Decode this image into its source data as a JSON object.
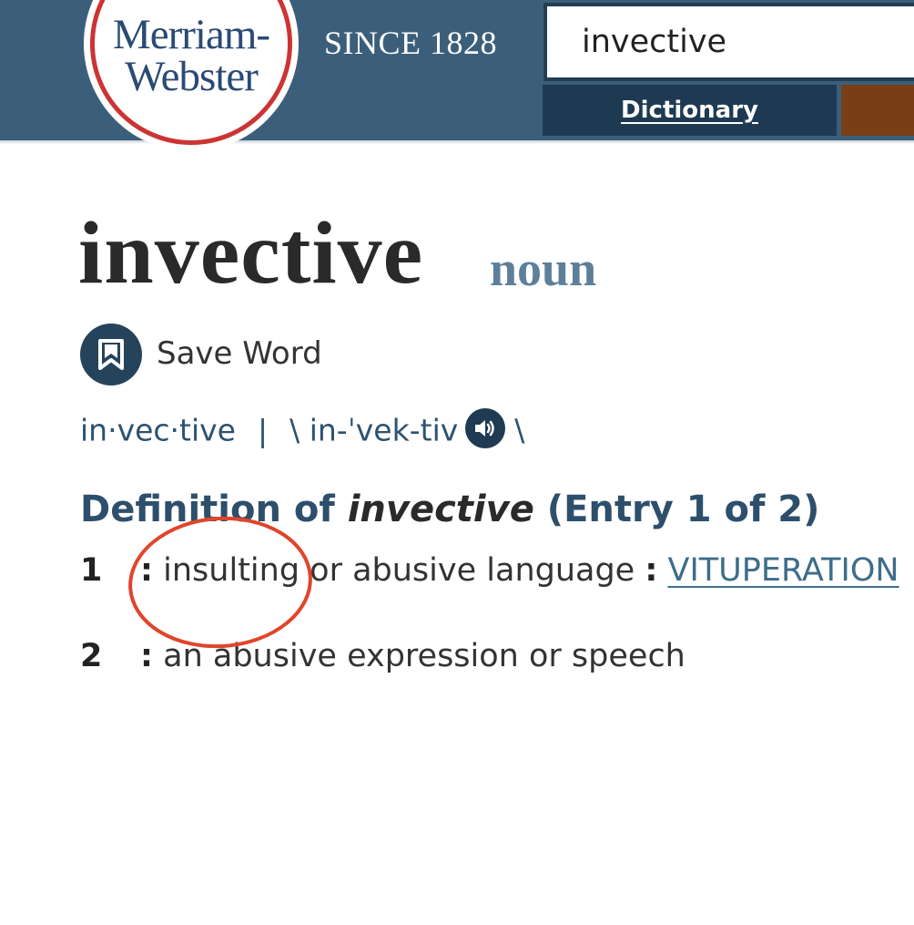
{
  "header": {
    "logo": {
      "line1": "Merriam-",
      "line2": "Webster"
    },
    "tagline": "SINCE 1828",
    "search": {
      "value": "invective"
    },
    "tabs": [
      {
        "label": "Dictionary",
        "active": true
      }
    ],
    "colors": {
      "background": "#3b5f7b",
      "logo_ring": "#cc3434",
      "thesaurus_tab": "#7a3e16"
    }
  },
  "entry": {
    "headword": "invective",
    "part_of_speech": "noun",
    "save_label": "Save Word",
    "syllables": "in·vec·tive",
    "separator": "|",
    "pron_open": "\\ in-ˈvek-tiv",
    "pron_close": "\\",
    "definition_heading": {
      "prefix": "Definition of",
      "word": "invective",
      "suffix": "(Entry 1 of 2)"
    },
    "senses": [
      {
        "number": "1",
        "colon": ":",
        "text": "insulting or abusive language",
        "sep": ":",
        "synonym": "VITUPERATION"
      },
      {
        "number": "2",
        "colon": ":",
        "text": "an abusive expression or speech"
      }
    ]
  },
  "icons": {
    "save": "bookmark-icon",
    "audio": "speaker-icon"
  },
  "annotation": {
    "shape": "ellipse",
    "color": "#e0452b"
  }
}
